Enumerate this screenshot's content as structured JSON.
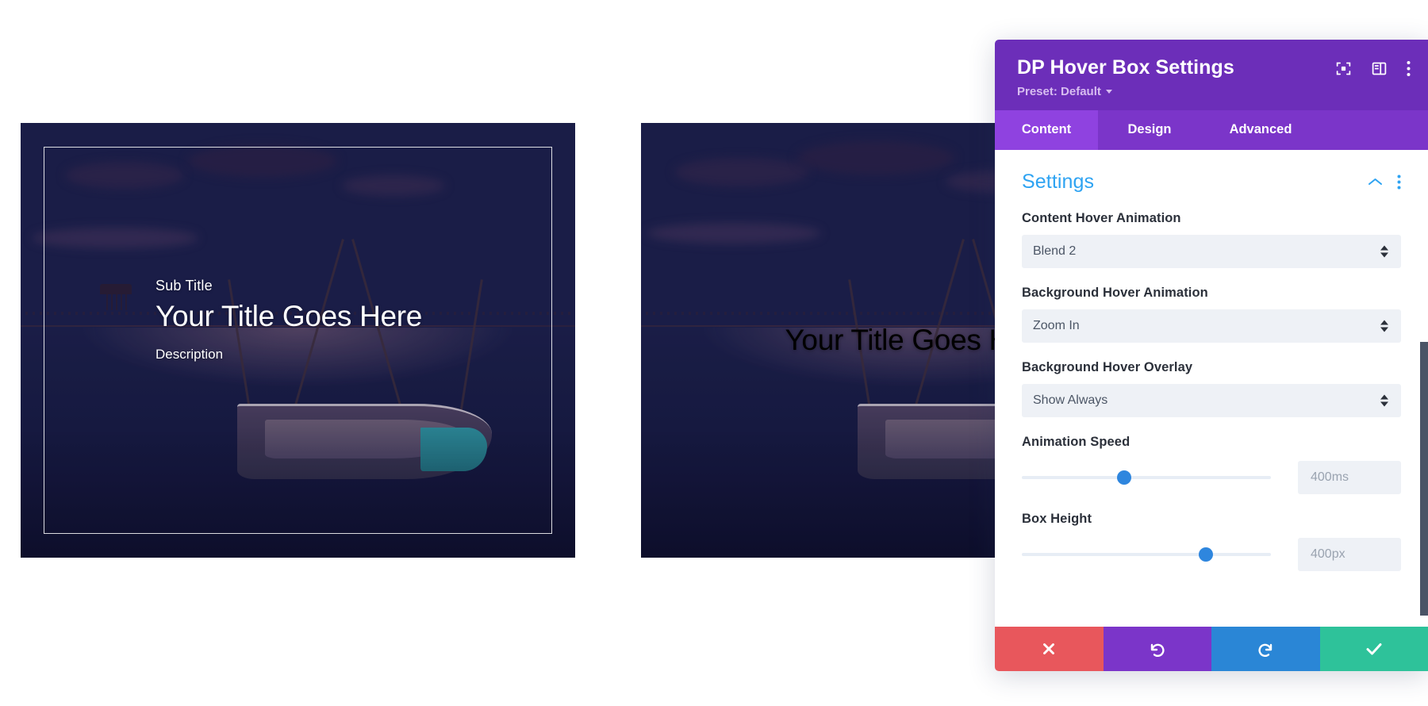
{
  "cards": [
    {
      "name": "hover-box-card-1",
      "sub_title": "Sub Title",
      "title": "Your Title Goes Here",
      "description": "Description",
      "layout": "left-aligned-with-border"
    },
    {
      "name": "hover-box-card-2",
      "title": "Your Title Goes Here",
      "layout": "centered"
    }
  ],
  "panel": {
    "title": "DP Hover Box Settings",
    "preset_label": "Preset: Default",
    "header_icons": [
      {
        "name": "focus-icon",
        "label": "focus"
      },
      {
        "name": "layout-panel-icon",
        "label": "layout"
      },
      {
        "name": "more-vertical-icon",
        "label": "more options"
      }
    ],
    "tabs": [
      {
        "label": "Content",
        "active": true
      },
      {
        "label": "Design",
        "active": false
      },
      {
        "label": "Advanced",
        "active": false
      }
    ],
    "section": {
      "title": "Settings",
      "collapse_icon": "chevron-up-icon",
      "more_icon": "more-vertical-icon"
    },
    "fields": [
      {
        "type": "select",
        "label": "Content Hover Animation",
        "value": "Blend 2"
      },
      {
        "type": "select",
        "label": "Background Hover Animation",
        "value": "Zoom In"
      },
      {
        "type": "select",
        "label": "Background Hover Overlay",
        "value": "Show Always"
      },
      {
        "type": "slider",
        "label": "Animation Speed",
        "value": "400ms",
        "handle_percent": 41
      },
      {
        "type": "slider",
        "label": "Box Height",
        "value": "400px",
        "handle_percent": 74
      }
    ],
    "footer_buttons": [
      {
        "name": "cancel-button",
        "icon": "close-icon",
        "color": "#e8575c"
      },
      {
        "name": "undo-button",
        "icon": "undo-icon",
        "color": "#7b35c9"
      },
      {
        "name": "redo-button",
        "icon": "redo-icon",
        "color": "#2a86d6"
      },
      {
        "name": "save-button",
        "icon": "check-icon",
        "color": "#2ec29a"
      }
    ]
  },
  "colors": {
    "header_purple": "#6c2eb9",
    "tab_bar_purple": "#7b35c9",
    "tab_active_purple": "#8f42e0",
    "section_blue": "#2ea3f2",
    "input_bg": "#eef1f6",
    "slider_blue": "#2e86de"
  }
}
